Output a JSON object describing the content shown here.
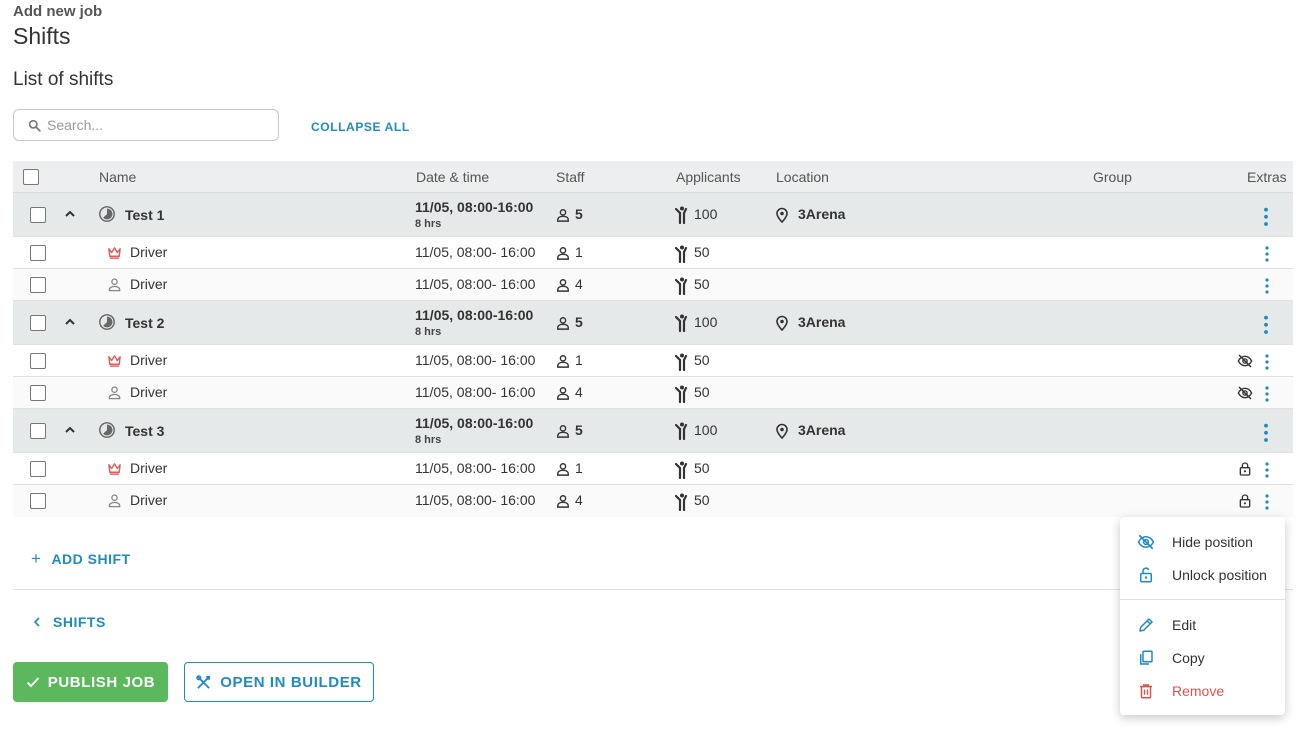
{
  "header": {
    "breadcrumb": "Add new job",
    "title": "Shifts",
    "section_title": "List of shifts"
  },
  "search": {
    "placeholder": "Search..."
  },
  "toolbar": {
    "collapse_all": "COLLAPSE ALL"
  },
  "table": {
    "columns": {
      "name": "Name",
      "date": "Date & time",
      "staff": "Staff",
      "applicants": "Applicants",
      "location": "Location",
      "group": "Group",
      "extras": "Extras"
    },
    "shifts": [
      {
        "name": "Test 1",
        "date": "11/05, 08:00-16:00",
        "hours": "8 hrs",
        "staff": "5",
        "applicants": "100",
        "location": "3Arena",
        "positions": [
          {
            "role": "Driver",
            "icon": "crown-icon",
            "date": "11/05, 08:00- 16:00",
            "staff": "1",
            "applicants": "50",
            "extra": ""
          },
          {
            "role": "Driver",
            "icon": "person-icon",
            "date": "11/05, 08:00- 16:00",
            "staff": "4",
            "applicants": "50",
            "extra": ""
          }
        ]
      },
      {
        "name": "Test 2",
        "date": "11/05, 08:00-16:00",
        "hours": "8 hrs",
        "staff": "5",
        "applicants": "100",
        "location": "3Arena",
        "positions": [
          {
            "role": "Driver",
            "icon": "crown-icon",
            "date": "11/05, 08:00- 16:00",
            "staff": "1",
            "applicants": "50",
            "extra": "hidden-eye-icon"
          },
          {
            "role": "Driver",
            "icon": "person-icon",
            "date": "11/05, 08:00- 16:00",
            "staff": "4",
            "applicants": "50",
            "extra": "hidden-eye-icon"
          }
        ]
      },
      {
        "name": "Test 3",
        "date": "11/05, 08:00-16:00",
        "hours": "8 hrs",
        "staff": "5",
        "applicants": "100",
        "location": "3Arena",
        "positions": [
          {
            "role": "Driver",
            "icon": "crown-icon",
            "date": "11/05, 08:00- 16:00",
            "staff": "1",
            "applicants": "50",
            "extra": "lock-icon"
          },
          {
            "role": "Driver",
            "icon": "person-icon",
            "date": "11/05, 08:00- 16:00",
            "staff": "4",
            "applicants": "50",
            "extra": "lock-icon"
          }
        ]
      }
    ]
  },
  "actions": {
    "add_shift": "ADD SHIFT",
    "back_shifts": "SHIFTS",
    "publish": "PUBLISH JOB",
    "open_builder": "OPEN IN BUILDER"
  },
  "context_menu": {
    "items": [
      {
        "label": "Hide position",
        "icon": "eye-off-icon"
      },
      {
        "label": "Unlock position",
        "icon": "unlock-icon"
      },
      {
        "label": "Edit",
        "icon": "pencil-icon"
      },
      {
        "label": "Copy",
        "icon": "copy-icon"
      },
      {
        "label": "Remove",
        "icon": "trash-icon"
      }
    ]
  },
  "colors": {
    "accent": "#1e8bc3",
    "publish": "#5cb85c",
    "danger": "#d9534f",
    "crown": "#e05a5a",
    "group_row": "#e6e9ea"
  }
}
